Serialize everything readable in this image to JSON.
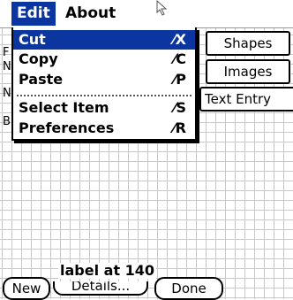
{
  "menubar": {
    "menus": [
      "Edit",
      "About"
    ]
  },
  "edit_menu": {
    "items": [
      {
        "label": "Cut",
        "shortcut": "⁄X"
      },
      {
        "label": "Copy",
        "shortcut": "⁄C"
      },
      {
        "label": "Paste",
        "shortcut": "⁄P"
      },
      {
        "label": "Select Item",
        "shortcut": "⁄S"
      },
      {
        "label": "Preferences",
        "shortcut": "⁄R"
      }
    ]
  },
  "side_buttons": {
    "shapes": "Shapes",
    "images": "Images",
    "text_entry": "Text Entry"
  },
  "hidden_fragments": {
    "frag1": "F",
    "frag2": "N",
    "frag3": "N",
    "frag4": "B"
  },
  "footer": {
    "label": "label at 140",
    "new_button": "New",
    "details_button": "Details...",
    "done_button": "Done"
  },
  "colors": {
    "highlight": "#0b36a0",
    "grid": "#c8c8c8"
  }
}
